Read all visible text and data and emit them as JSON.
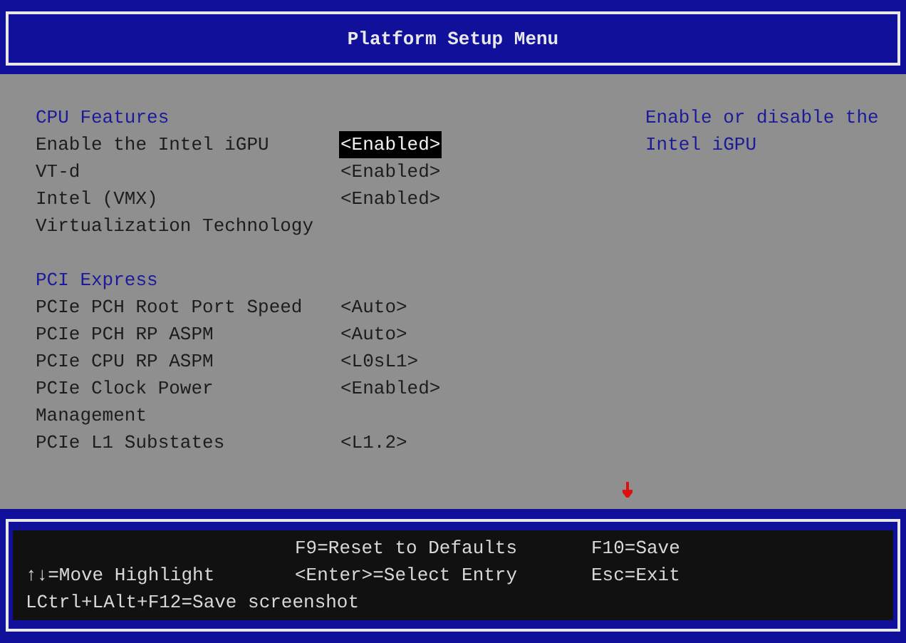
{
  "window": {
    "title": "Platform Setup Menu"
  },
  "sections": [
    {
      "heading": "CPU Features",
      "settings": [
        {
          "label": "Enable the Intel iGPU",
          "value": "<Enabled>",
          "selected": true
        },
        {
          "label": "VT-d",
          "value": "<Enabled>",
          "selected": false
        },
        {
          "label": "Intel (VMX) Virtualization Technology",
          "value": "<Enabled>",
          "selected": false
        }
      ]
    },
    {
      "heading": "PCI Express",
      "settings": [
        {
          "label": "PCIe PCH Root Port Speed",
          "value": "<Auto>",
          "selected": false
        },
        {
          "label": "PCIe PCH RP ASPM",
          "value": "<Auto>",
          "selected": false
        },
        {
          "label": "PCIe CPU RP ASPM",
          "value": "<L0sL1>",
          "selected": false
        },
        {
          "label": "PCIe Clock Power Management",
          "value": "<Enabled>",
          "selected": false
        },
        {
          "label": "PCIe L1 Substates",
          "value": "<L1.2>",
          "selected": false
        }
      ]
    }
  ],
  "help": "Enable or disable the Intel iGPU",
  "footer": {
    "hints": [
      "F9=Reset to Defaults",
      "F10=Save",
      "↑↓=Move Highlight",
      "<Enter>=Select Entry",
      "Esc=Exit",
      "LCtrl+LAlt+F12=Save screenshot"
    ]
  }
}
